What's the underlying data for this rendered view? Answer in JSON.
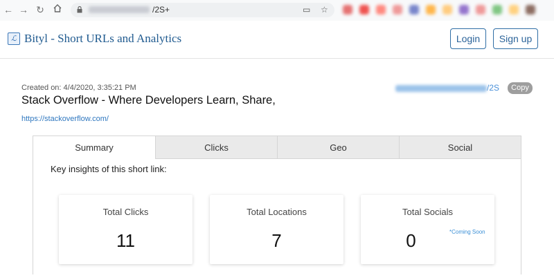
{
  "browser": {
    "url_tail": "/2S+",
    "icons": [
      "back-arrow-icon",
      "forward-arrow-icon",
      "reload-icon",
      "home-icon",
      "lock-icon",
      "cast-icon",
      "star-icon"
    ],
    "extension_colors": [
      "#e57373",
      "#ef5350",
      "#ff8a80",
      "#ef9a9a",
      "#7986cb",
      "#ffb74d",
      "#ffcc80",
      "#9575cd",
      "#ef9a9a",
      "#81c784",
      "#ffd180",
      "#8d6e63"
    ]
  },
  "header": {
    "brand": "Bityl - Short URLs and Analytics",
    "login_label": "Login",
    "signup_label": "Sign up"
  },
  "link": {
    "created": "Created on: 4/4/2020, 3:35:21 PM",
    "title": "Stack Overflow - Where Developers Learn, Share,",
    "original_url": "https://stackoverflow.com/",
    "short_url_tail": "/2S",
    "copy_label": "Copy"
  },
  "tabs": [
    "Summary",
    "Clicks",
    "Geo",
    "Social"
  ],
  "summary": {
    "heading": "Key insights of this short link:",
    "cards": [
      {
        "label": "Total Clicks",
        "value": "11"
      },
      {
        "label": "Total Locations",
        "value": "7"
      },
      {
        "label": "Total Socials",
        "value": "0",
        "note": "*Coming Soon"
      }
    ]
  },
  "colors": {
    "brand": "#1f5a8f",
    "link": "#2f77bf",
    "button_border": "#2f6ea5"
  }
}
